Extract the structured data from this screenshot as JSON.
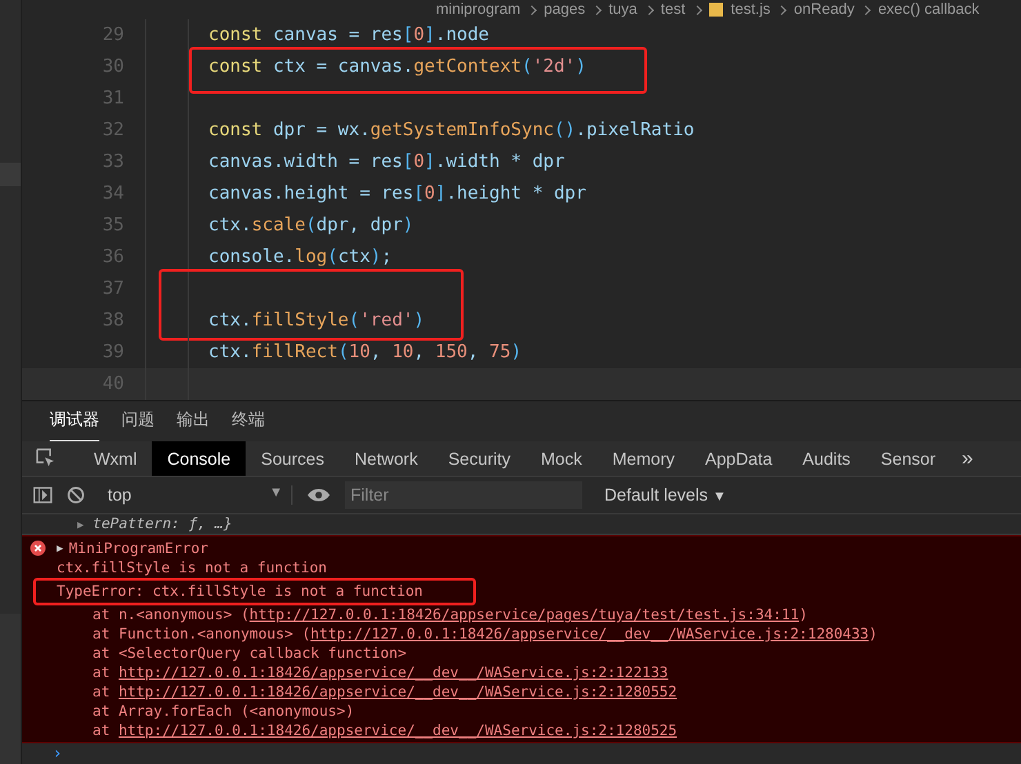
{
  "breadcrumb": [
    "miniprogram",
    "pages",
    "tuya",
    "test",
    "test.js",
    "onReady",
    "exec() callback"
  ],
  "editor": {
    "lines": [
      {
        "number": "29",
        "boxed": false,
        "current": false,
        "tokens": [
          {
            "text": "const",
            "kind": "k"
          },
          {
            "text": " canvas = res",
            "kind": "v"
          },
          {
            "text": "[",
            "kind": "b"
          },
          {
            "text": "0",
            "kind": "n"
          },
          {
            "text": "]",
            "kind": "b"
          },
          {
            "text": ".node",
            "kind": "v"
          }
        ]
      },
      {
        "number": "30",
        "boxed": true,
        "current": false,
        "tokens": [
          {
            "text": "const",
            "kind": "k"
          },
          {
            "text": " ctx = canvas.",
            "kind": "v"
          },
          {
            "text": "getContext",
            "kind": "f"
          },
          {
            "text": "(",
            "kind": "b"
          },
          {
            "text": "'2d'",
            "kind": "s"
          },
          {
            "text": ")",
            "kind": "b"
          }
        ]
      },
      {
        "number": "31",
        "boxed": false,
        "current": false
      },
      {
        "number": "32",
        "boxed": false,
        "current": false,
        "tokens": [
          {
            "text": "const",
            "kind": "k"
          },
          {
            "text": " dpr = wx.",
            "kind": "v"
          },
          {
            "text": "getSystemInfoSync",
            "kind": "f"
          },
          {
            "text": "()",
            "kind": "b"
          },
          {
            "text": ".pixelRatio",
            "kind": "v"
          }
        ]
      },
      {
        "number": "33",
        "boxed": false,
        "current": false,
        "tokens": [
          {
            "text": "canvas.width = res",
            "kind": "v"
          },
          {
            "text": "[",
            "kind": "b"
          },
          {
            "text": "0",
            "kind": "n"
          },
          {
            "text": "]",
            "kind": "b"
          },
          {
            "text": ".width * dpr",
            "kind": "v"
          }
        ]
      },
      {
        "number": "34",
        "boxed": false,
        "current": false,
        "tokens": [
          {
            "text": "canvas.height = res",
            "kind": "v"
          },
          {
            "text": "[",
            "kind": "b"
          },
          {
            "text": "0",
            "kind": "n"
          },
          {
            "text": "]",
            "kind": "b"
          },
          {
            "text": ".height * dpr",
            "kind": "v"
          }
        ]
      },
      {
        "number": "35",
        "boxed": false,
        "current": false,
        "tokens": [
          {
            "text": "ctx.",
            "kind": "v"
          },
          {
            "text": "scale",
            "kind": "f"
          },
          {
            "text": "(",
            "kind": "b"
          },
          {
            "text": "dpr, dpr",
            "kind": "v"
          },
          {
            "text": ")",
            "kind": "b"
          }
        ]
      },
      {
        "number": "36",
        "boxed": false,
        "current": false,
        "tokens": [
          {
            "text": "console.",
            "kind": "v"
          },
          {
            "text": "log",
            "kind": "f"
          },
          {
            "text": "(",
            "kind": "b"
          },
          {
            "text": "ctx",
            "kind": "v"
          },
          {
            "text": ")",
            "kind": "b"
          },
          {
            "text": ";",
            "kind": "v"
          }
        ]
      },
      {
        "number": "37",
        "boxed": false,
        "current": false
      },
      {
        "number": "38",
        "boxed": true,
        "current": false,
        "tokens": [
          {
            "text": "ctx.",
            "kind": "v"
          },
          {
            "text": "fillStyle",
            "kind": "f"
          },
          {
            "text": "(",
            "kind": "b"
          },
          {
            "text": "'red'",
            "kind": "s"
          },
          {
            "text": ")",
            "kind": "b"
          }
        ]
      },
      {
        "number": "39",
        "boxed": false,
        "current": false,
        "tokens": [
          {
            "text": "ctx.",
            "kind": "v"
          },
          {
            "text": "fillRect",
            "kind": "f"
          },
          {
            "text": "(",
            "kind": "b"
          },
          {
            "text": "10",
            "kind": "n"
          },
          {
            "text": ", ",
            "kind": "v"
          },
          {
            "text": "10",
            "kind": "n"
          },
          {
            "text": ", ",
            "kind": "v"
          },
          {
            "text": "150",
            "kind": "n"
          },
          {
            "text": ", ",
            "kind": "v"
          },
          {
            "text": "75",
            "kind": "n"
          },
          {
            "text": ")",
            "kind": "b"
          }
        ]
      },
      {
        "number": "40",
        "boxed": false,
        "current": true
      }
    ]
  },
  "panel_tabs": [
    {
      "label": "调试器",
      "selected": true
    },
    {
      "label": "问题",
      "selected": false
    },
    {
      "label": "输出",
      "selected": false
    },
    {
      "label": "终端",
      "selected": false
    }
  ],
  "devtools_tabs": [
    {
      "label": "Wxml",
      "selected": false
    },
    {
      "label": "Console",
      "selected": true
    },
    {
      "label": "Sources",
      "selected": false
    },
    {
      "label": "Network",
      "selected": false
    },
    {
      "label": "Security",
      "selected": false
    },
    {
      "label": "Mock",
      "selected": false
    },
    {
      "label": "Memory",
      "selected": false
    },
    {
      "label": "AppData",
      "selected": false
    },
    {
      "label": "Audits",
      "selected": false
    },
    {
      "label": "Sensor",
      "selected": false
    }
  ],
  "more_tabs": "»",
  "toolbar": {
    "context": "top",
    "context_caret": "▼",
    "filter": {
      "placeholder": "Filter"
    },
    "levels": "Default levels",
    "levels_caret": "▼"
  },
  "console": {
    "partial_line": {
      "toggle": "▶",
      "text": "tePattern: ƒ, …}"
    },
    "error": {
      "toggle": "▶",
      "title": "MiniProgramError",
      "messages": [
        {
          "text": "ctx.fillStyle is not a function",
          "boxed": false
        },
        {
          "text": "TypeError: ctx.fillStyle is not a function",
          "boxed": true
        }
      ],
      "stack": [
        {
          "prefix": "at n.<anonymous> (",
          "link": "http://127.0.0.1:18426/appservice/pages/tuya/test/test.js:34:11",
          "suffix": ")"
        },
        {
          "prefix": "at Function.<anonymous> (",
          "link": "http://127.0.0.1:18426/appservice/__dev__/WAService.js:2:1280433",
          "suffix": ")"
        },
        {
          "prefix": "at <SelectorQuery callback function>"
        },
        {
          "prefix": "at ",
          "link": "http://127.0.0.1:18426/appservice/__dev__/WAService.js:2:122133"
        },
        {
          "prefix": "at ",
          "link": "http://127.0.0.1:18426/appservice/__dev__/WAService.js:2:1280552"
        },
        {
          "prefix": "at Array.forEach (<anonymous>)"
        },
        {
          "prefix": "at ",
          "link": "http://127.0.0.1:18426/appservice/__dev__/WAService.js:2:1280525"
        }
      ]
    },
    "prompt": "›"
  }
}
